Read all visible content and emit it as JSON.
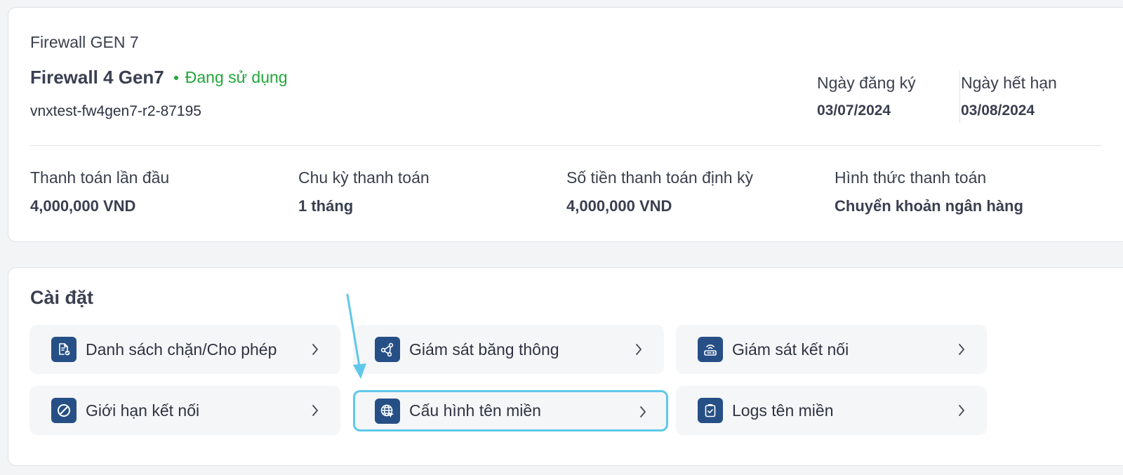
{
  "service": {
    "category": "Firewall GEN 7",
    "product_name": "Firewall 4 Gen7",
    "status": "Đang sử dụng",
    "hostname": "vnxtest-fw4gen7-r2-87195",
    "registered_label": "Ngày đăng ký",
    "registered_date": "03/07/2024",
    "expiry_label": "Ngày hết hạn",
    "expiry_date": "03/08/2024",
    "payments": [
      {
        "label": "Thanh toán lần đầu",
        "value": "4,000,000 VND"
      },
      {
        "label": "Chu kỳ thanh toán",
        "value": "1 tháng"
      },
      {
        "label": "Số tiền thanh toán định kỳ",
        "value": "4,000,000 VND"
      },
      {
        "label": "Hình thức thanh toán",
        "value": "Chuyển khoản ngân hàng"
      }
    ]
  },
  "settings": {
    "title": "Cài đặt",
    "items": [
      {
        "label": "Danh sách chặn/Cho phép",
        "icon": "document-shield-icon"
      },
      {
        "label": "Giám sát băng thông",
        "icon": "share-nodes-icon"
      },
      {
        "label": "Giám sát kết nối",
        "icon": "router-icon"
      },
      {
        "label": "Giới hạn kết nối",
        "icon": "block-icon"
      },
      {
        "label": "Cấu hình tên miền",
        "icon": "globe-cursor-icon",
        "highlighted": true
      },
      {
        "label": "Logs tên miền",
        "icon": "clipboard-check-icon"
      }
    ]
  },
  "colors": {
    "status_green": "#22a63a",
    "icon_bg": "#264f86",
    "highlight_border": "#5fc8ea"
  }
}
